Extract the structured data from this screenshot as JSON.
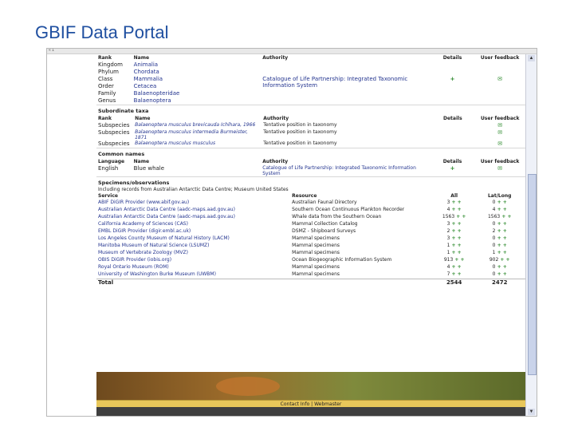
{
  "slide": {
    "title": "GBIF Data Portal"
  },
  "browser": {
    "frame_tag": "« 1"
  },
  "classification": {
    "headers": {
      "rank": "Rank",
      "name": "Name",
      "authority": "Authority",
      "details": "Details",
      "user_feedback": "User feedback"
    },
    "rows": [
      {
        "rank": "Kingdom",
        "name": "Animalia",
        "authority": "",
        "details": "",
        "feedback": ""
      },
      {
        "rank": "Phylum",
        "name": "Chordata",
        "authority": "",
        "details": "",
        "feedback": ""
      },
      {
        "rank": "Class",
        "name": "Mammalia",
        "authority": "Catalogue of Life Partnership: Integrated Taxonomic Information System",
        "details": "+",
        "feedback": "✉"
      },
      {
        "rank": "Order",
        "name": "Cetacea",
        "authority": "",
        "details": "",
        "feedback": ""
      },
      {
        "rank": "Family",
        "name": "Balaenopteridae",
        "authority": "",
        "details": "",
        "feedback": ""
      },
      {
        "rank": "Genus",
        "name": "Balaenoptera",
        "authority": "",
        "details": "",
        "feedback": ""
      }
    ]
  },
  "subordinate": {
    "title": "Subordinate taxa",
    "headers": {
      "rank": "Rank",
      "name": "Name",
      "authority": "Authority",
      "details": "Details",
      "user_feedback": "User feedback"
    },
    "rows": [
      {
        "rank": "Subspecies",
        "name": "Balaenoptera musculus brevicauda Ichihara, 1966",
        "authority": "Tentative position in taxonomy",
        "feedback": "✉"
      },
      {
        "rank": "Subspecies",
        "name": "Balaenoptera musculus intermedia Burmeister, 1871",
        "authority": "Tentative position in taxonomy",
        "feedback": "✉"
      },
      {
        "rank": "Subspecies",
        "name": "Balaenoptera musculus musculus",
        "authority": "Tentative position in taxonomy",
        "feedback": "✉"
      }
    ]
  },
  "common_names": {
    "title": "Common names",
    "headers": {
      "language": "Language",
      "name": "Name",
      "authority": "Authority",
      "details": "Details",
      "user_feedback": "User feedback"
    },
    "rows": [
      {
        "language": "English",
        "name": "Blue whale",
        "authority": "Catalogue of Life Partnership: Integrated Taxonomic Information System",
        "details": "+",
        "feedback": "✉"
      }
    ]
  },
  "specimens": {
    "title": "Specimens/observations",
    "subtitle": "Including records from Australian Antarctic Data Centre; Museum United States",
    "headers": {
      "service": "Service",
      "resource": "Resource",
      "all": "All",
      "latlong": "Lat/Long"
    },
    "rows": [
      {
        "service": "ABIF DiGIR Provider (www.abif.gov.au)",
        "resource": "Australian Faunal Directory",
        "all": "3",
        "latlong": "0"
      },
      {
        "service": "Australian Antarctic Data Centre (aadc-maps.aad.gov.au)",
        "resource": "Southern Ocean Continuous Plankton Recorder",
        "all": "4",
        "latlong": "4"
      },
      {
        "service": "Australian Antarctic Data Centre (aadc-maps.aad.gov.au)",
        "resource": "Whale data from the Southern Ocean",
        "all": "1563",
        "latlong": "1563"
      },
      {
        "service": "California Academy of Sciences (CAS)",
        "resource": "Mammal Collection Catalog",
        "all": "3",
        "latlong": "0"
      },
      {
        "service": "EMBL DiGIR Provider (digir.embl.ac.uk)",
        "resource": "DSMZ - Shipboard Surveys",
        "all": "2",
        "latlong": "2"
      },
      {
        "service": "Los Angeles County Museum of Natural History (LACM)",
        "resource": "Mammal specimens",
        "all": "3",
        "latlong": "0"
      },
      {
        "service": "Manitoba Museum of Natural Science (LSUMZ)",
        "resource": "Mammal specimens",
        "all": "1",
        "latlong": "0"
      },
      {
        "service": "Museum of Vertebrate Zoology (MVZ)",
        "resource": "Mammal specimens",
        "all": "1",
        "latlong": "1"
      },
      {
        "service": "OBIS DiGIR Provider (iobis.org)",
        "resource": "Ocean Biogeographic Information System",
        "all": "913",
        "latlong": "902"
      },
      {
        "service": "Royal Ontario Museum (ROM)",
        "resource": "Mammal specimens",
        "all": "4",
        "latlong": "0"
      },
      {
        "service": "University of Washington Burke Museum (UWBM)",
        "resource": "Mammal specimens",
        "all": "7",
        "latlong": "0"
      }
    ],
    "total": {
      "label": "Total",
      "all": "2544",
      "latlong": "2472"
    }
  },
  "footer": {
    "text": "Contact Info | Webmaster"
  },
  "icons": {
    "plus": "plus-icon",
    "feedback": "feedback-envelope-icon"
  }
}
